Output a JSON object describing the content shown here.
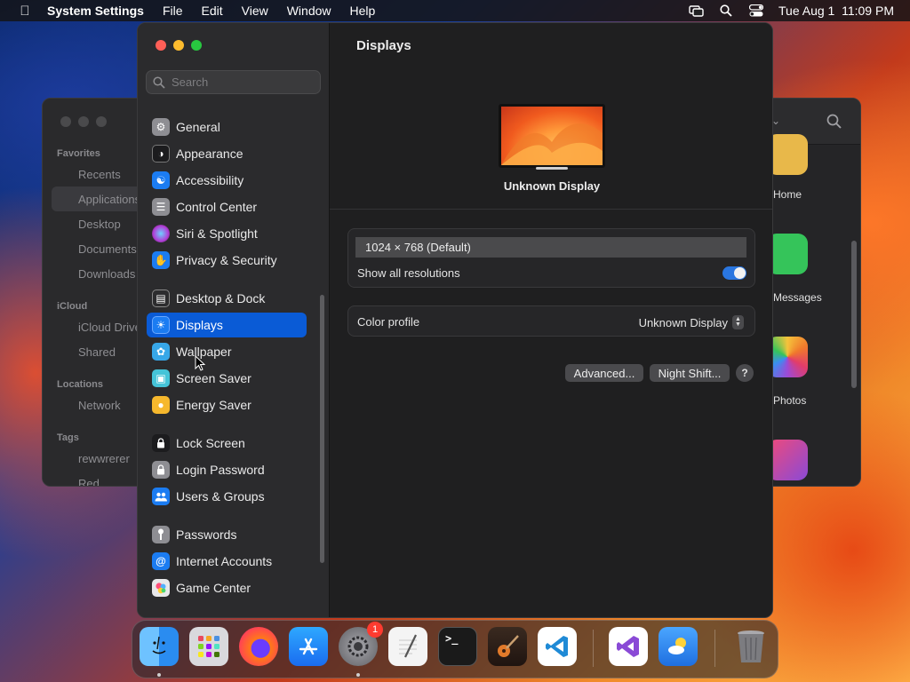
{
  "menubar": {
    "app_name": "System Settings",
    "menus": [
      "File",
      "Edit",
      "View",
      "Window",
      "Help"
    ],
    "clock": "Tue Aug 1  11:09 PM"
  },
  "finder": {
    "sections": [
      {
        "label": "Favorites",
        "items": [
          "Recents",
          "Applications",
          "Desktop",
          "Documents",
          "Downloads"
        ]
      },
      {
        "label": "iCloud",
        "items": [
          "iCloud Drive",
          "Shared"
        ]
      },
      {
        "label": "Locations",
        "items": [
          "Network"
        ]
      },
      {
        "label": "Tags",
        "items": [
          "rewwrerer",
          "Red"
        ]
      }
    ],
    "app_labels": [
      "Home",
      "Messages",
      "Photos"
    ]
  },
  "settings": {
    "search_placeholder": "Search",
    "sidebar": [
      {
        "label": "General",
        "icon": "gear-icon",
        "color": "#8e8e93"
      },
      {
        "label": "Appearance",
        "icon": "appearance-icon",
        "color": "#1c1c1e"
      },
      {
        "label": "Accessibility",
        "icon": "accessibility-icon",
        "color": "#1b7cf2"
      },
      {
        "label": "Control Center",
        "icon": "control-center-icon",
        "color": "#8e8e93"
      },
      {
        "label": "Siri & Spotlight",
        "icon": "siri-icon",
        "color": "#b23dd6"
      },
      {
        "label": "Privacy & Security",
        "icon": "hand-icon",
        "color": "#1b7cf2"
      },
      {
        "label": "Desktop & Dock",
        "icon": "dock-icon",
        "color": "#2c2c2e"
      },
      {
        "label": "Displays",
        "icon": "sun-icon",
        "color": "#1b7cf2"
      },
      {
        "label": "Wallpaper",
        "icon": "flower-icon",
        "color": "#37a7e8"
      },
      {
        "label": "Screen Saver",
        "icon": "screen-saver-icon",
        "color": "#45c4d8"
      },
      {
        "label": "Energy Saver",
        "icon": "bulb-icon",
        "color": "#f6b82d"
      },
      {
        "label": "Lock Screen",
        "icon": "lock-icon",
        "color": "#1c1c1e"
      },
      {
        "label": "Login Password",
        "icon": "key-lock-icon",
        "color": "#8e8e93"
      },
      {
        "label": "Users & Groups",
        "icon": "users-icon",
        "color": "#1b7cf2"
      },
      {
        "label": "Passwords",
        "icon": "key-icon",
        "color": "#8e8e93"
      },
      {
        "label": "Internet Accounts",
        "icon": "at-icon",
        "color": "#1b7cf2"
      },
      {
        "label": "Game Center",
        "icon": "game-center-icon",
        "color": "#e8e8ea"
      }
    ],
    "selected": "Displays",
    "pane": {
      "title": "Displays",
      "display_name": "Unknown Display",
      "resolution": "1024 × 768 (Default)",
      "show_all_label": "Show all resolutions",
      "show_all_on": true,
      "color_profile_label": "Color profile",
      "color_profile_value": "Unknown Display",
      "advanced_label": "Advanced...",
      "night_shift_label": "Night Shift...",
      "help_label": "?"
    }
  },
  "dock": {
    "apps": [
      {
        "name": "Finder",
        "icon": "finder-icon",
        "color": "#2a8cf0",
        "running": true
      },
      {
        "name": "Launchpad",
        "icon": "launchpad-icon",
        "color": "#d9d9dd",
        "running": false
      },
      {
        "name": "Firefox",
        "icon": "firefox-icon",
        "color": "#ff7a18",
        "running": false
      },
      {
        "name": "App Store",
        "icon": "app-store-icon",
        "color": "#1a8cff",
        "running": false
      },
      {
        "name": "System Settings",
        "icon": "settings-gear-icon",
        "color": "#7a7a80",
        "running": true,
        "badge": "1"
      },
      {
        "name": "TextEdit",
        "icon": "textedit-icon",
        "color": "#f4f4f4",
        "running": false
      },
      {
        "name": "Terminal",
        "icon": "terminal-icon",
        "color": "#1a1a1a",
        "running": false
      },
      {
        "name": "GarageBand",
        "icon": "guitar-icon",
        "color": "#e27a2a",
        "running": false
      },
      {
        "name": "Visual Studio Code",
        "icon": "vscode-icon",
        "color": "#ffffff",
        "running": false
      },
      {
        "name": "Visual Studio",
        "icon": "visual-studio-icon",
        "color": "#ffffff",
        "running": false
      },
      {
        "name": "Weather",
        "icon": "weather-icon",
        "color": "#2d8df0",
        "running": false
      },
      {
        "name": "Trash",
        "icon": "trash-icon",
        "color": "#6e6e72",
        "running": false
      }
    ]
  }
}
